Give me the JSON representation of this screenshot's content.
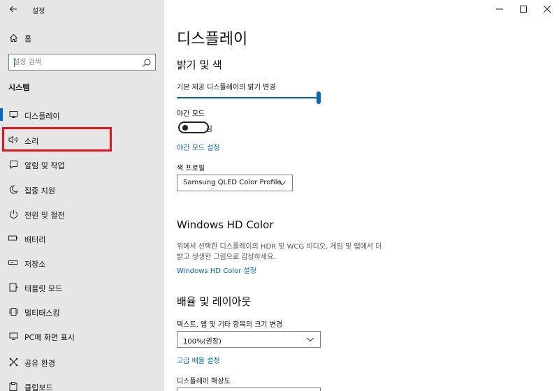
{
  "app": {
    "title": "설정"
  },
  "window": {
    "minimize": "—",
    "maximize": "☐",
    "close": "✕"
  },
  "sidebar": {
    "home_label": "홈",
    "search_placeholder": "설정 검색",
    "section_title": "시스템",
    "items": [
      {
        "label": "디스플레이",
        "icon": "monitor-icon",
        "selected": true
      },
      {
        "label": "소리",
        "icon": "speaker-icon",
        "selected": false
      },
      {
        "label": "알림 및 작업",
        "icon": "notification-icon",
        "selected": false
      },
      {
        "label": "집중 지원",
        "icon": "moon-icon",
        "selected": false
      },
      {
        "label": "전원 및 절전",
        "icon": "power-icon",
        "selected": false
      },
      {
        "label": "배터리",
        "icon": "battery-icon",
        "selected": false
      },
      {
        "label": "저장소",
        "icon": "storage-icon",
        "selected": false
      },
      {
        "label": "태블릿 모드",
        "icon": "tablet-icon",
        "selected": false
      },
      {
        "label": "멀티태스킹",
        "icon": "multitasking-icon",
        "selected": false
      },
      {
        "label": "PC에 화면 표시",
        "icon": "project-icon",
        "selected": false
      },
      {
        "label": "공유 환경",
        "icon": "shared-experiences-icon",
        "selected": false
      },
      {
        "label": "클립보드",
        "icon": "clipboard-icon",
        "selected": false
      }
    ]
  },
  "main": {
    "page_title": "디스플레이",
    "brightness_section": {
      "heading": "밝기 및 색",
      "brightness_label": "기본 제공 디스플레이의 밝기 변경",
      "brightness_value": 100,
      "night_light_label": "야간 모드",
      "night_light_state": "끔",
      "night_light_link": "야간 모드 설정",
      "color_profile_label": "색 프로필",
      "color_profile_value": "Samsung QLED Color Profile"
    },
    "hd_color_section": {
      "heading": "Windows HD Color",
      "description_line1": "위에서 선택한 디스플레이의 HDR 및 WCG 비디오, 게임 및 앱에서 더",
      "description_line2": "밝고 생생한 그림으로 감상하세요.",
      "link": "Windows HD Color 설정"
    },
    "scale_section": {
      "heading": "배율 및 레이아웃",
      "scale_label": "텍스트, 앱 및 기타 항목의 크기 변경",
      "scale_value": "100%(권장)",
      "advanced_link": "고급 배율 설정",
      "resolution_label": "디스플레이 해상도"
    }
  },
  "colors": {
    "accent": "#0067c0",
    "link": "#0067b8",
    "highlight_box": "#e8141c",
    "sidebar_bg": "#e6e6e6"
  }
}
